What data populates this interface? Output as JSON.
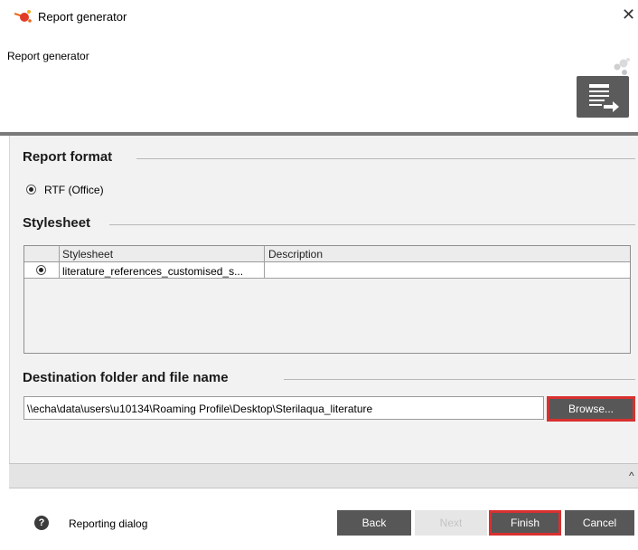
{
  "window": {
    "title": "Report generator",
    "close_label": "✕"
  },
  "header": {
    "subtitle": "Report generator"
  },
  "report_format": {
    "title": "Report format",
    "option_label": "RTF (Office)"
  },
  "stylesheet": {
    "title": "Stylesheet",
    "columns": [
      "Stylesheet",
      "Description"
    ],
    "rows": [
      {
        "stylesheet": "literature_references_customised_s...",
        "description": ""
      }
    ]
  },
  "destination": {
    "title": "Destination folder and file name",
    "path": "\\\\echa\\data\\users\\u10134\\Roaming Profile\\Desktop\\Sterilaqua_literature",
    "browse_label": "Browse..."
  },
  "footer": {
    "help_label": "Reporting dialog",
    "help_icon": "?",
    "caret": "^",
    "back_label": "Back",
    "next_label": "Next",
    "finish_label": "Finish",
    "cancel_label": "Cancel"
  },
  "colors": {
    "button_bg": "#575757",
    "highlight": "#d93030",
    "content_bg": "#f2f2f2"
  }
}
